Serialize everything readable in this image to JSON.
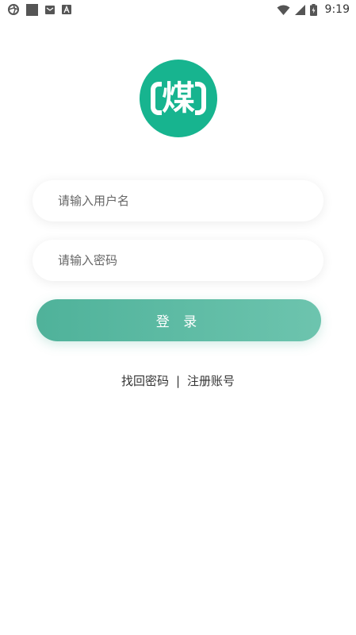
{
  "status_bar": {
    "time": "9:19",
    "left_icons": [
      "aperture-icon",
      "square-icon",
      "mail-icon",
      "font-a-icon"
    ],
    "right_icons": [
      "wifi-icon",
      "signal-icon",
      "battery-icon"
    ]
  },
  "logo": {
    "text": "煤",
    "color": "#17b48f"
  },
  "login_form": {
    "username_placeholder": "请输入用户名",
    "password_placeholder": "请输入密码",
    "login_label": "登 录",
    "button_color": "#5bb9a0"
  },
  "links": {
    "forgot_password": "找回密码",
    "separator": "|",
    "register": "注册账号"
  }
}
